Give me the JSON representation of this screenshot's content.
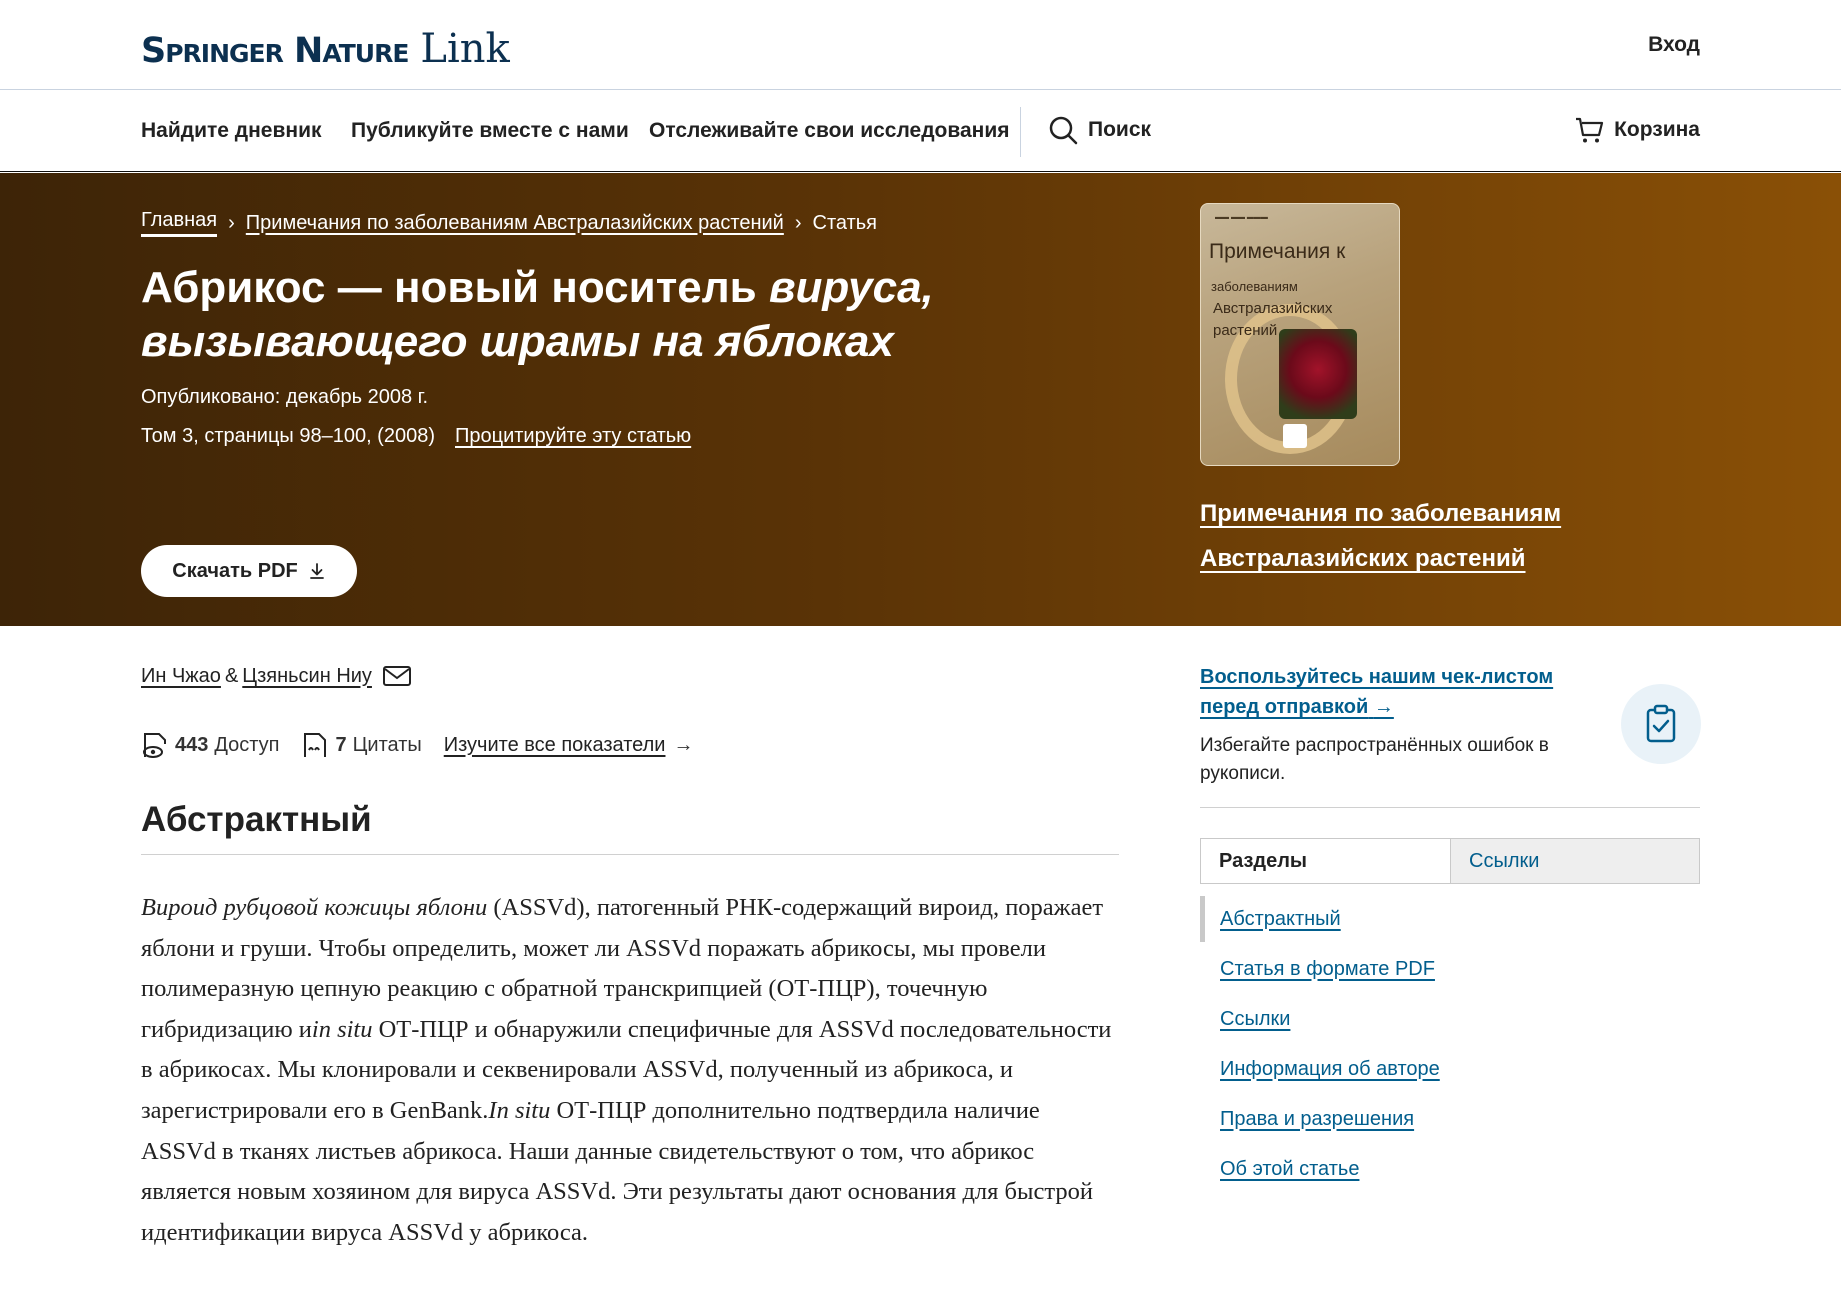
{
  "header": {
    "brand": "Springer Nature",
    "brand_suffix": "Link",
    "login": "Вход"
  },
  "nav": {
    "items": [
      "Найдите дневник",
      "Публикуйте вместе с нами",
      "Отслеживайте свои исследования"
    ],
    "search": "Поиск",
    "cart": "Корзина"
  },
  "breadcrumb": {
    "home": "Главная",
    "journal": "Примечания по заболеваниям Австралазийских растений",
    "current": "Статья"
  },
  "article": {
    "title_plain": "Абрикос — новый носитель ",
    "title_italic": "вируса, вызывающего шрамы на яблоках",
    "published": "Опубликовано: декабрь 2008 г.",
    "volume": "Том 3, страницы 98–100, (2008)",
    "cite": "Процитируйте эту статью",
    "download": "Скачать PDF"
  },
  "journal_cover": {
    "title": "Примечания к",
    "subtitle_1": "заболеваниям",
    "subtitle_2": "Австралазийских растений"
  },
  "journal_link": {
    "line1": "Примечания по заболеваниям",
    "line2": "Австралазийских растений"
  },
  "authors": {
    "author1": "Ин Чжао",
    "separator": "&",
    "author2": "Цзяньсин Ниу"
  },
  "metrics": {
    "accesses_count": "443",
    "accesses_label": "Доступ",
    "citations_count": "7",
    "citations_label": "Цитаты",
    "explore": "Изучите все показатели"
  },
  "abstract": {
    "heading": "Абстрактный",
    "italic_start": "Вироид рубцовой кожицы яблони",
    "text_1": " (ASSVd), патогенный РНК-содержащий вироид, поражает яблони и груши. Чтобы определить, может ли ASSVd поражать абрикосы, мы провели полимеразную цепную реакцию с обратной транскрипцией (ОТ-ПЦР), точечную гибридизацию и",
    "italic_mid": "in situ",
    "text_2": " ОТ-ПЦР и обнаружили специфичные для ASSVd последовательности в абрикосах. Мы клонировали и секвенировали ASSVd, полученный из абрикоса, и зарегистрировали его в GenBank.",
    "italic_mid2": "In situ",
    "text_3": " ОТ-ПЦР дополнительно подтвердила наличие ASSVd в тканях листьев абрикоса. Наши данные свидетельствуют о том, что абрикос является новым хозяином для вируса ASSVd. Эти результаты дают основания для быстрой идентификации вируса ASSVd у абрикоса."
  },
  "sidebar": {
    "checklist_link": "Воспользуйтесь нашим чек-листом перед отправкой",
    "checklist_desc": "Избегайте распространённых ошибок в рукописи.",
    "tabs": [
      "Разделы",
      "Ссылки"
    ],
    "toc": [
      "Абстрактный",
      "Статья в формате PDF",
      "Ссылки",
      "Информация об авторе",
      "Права и разрешения",
      "Об этой статье"
    ]
  },
  "colors": {
    "brand_navy": "#0c3050",
    "link_blue": "#025e8d",
    "hero_dark": "#3d2407",
    "hero_light": "#8a5006"
  }
}
